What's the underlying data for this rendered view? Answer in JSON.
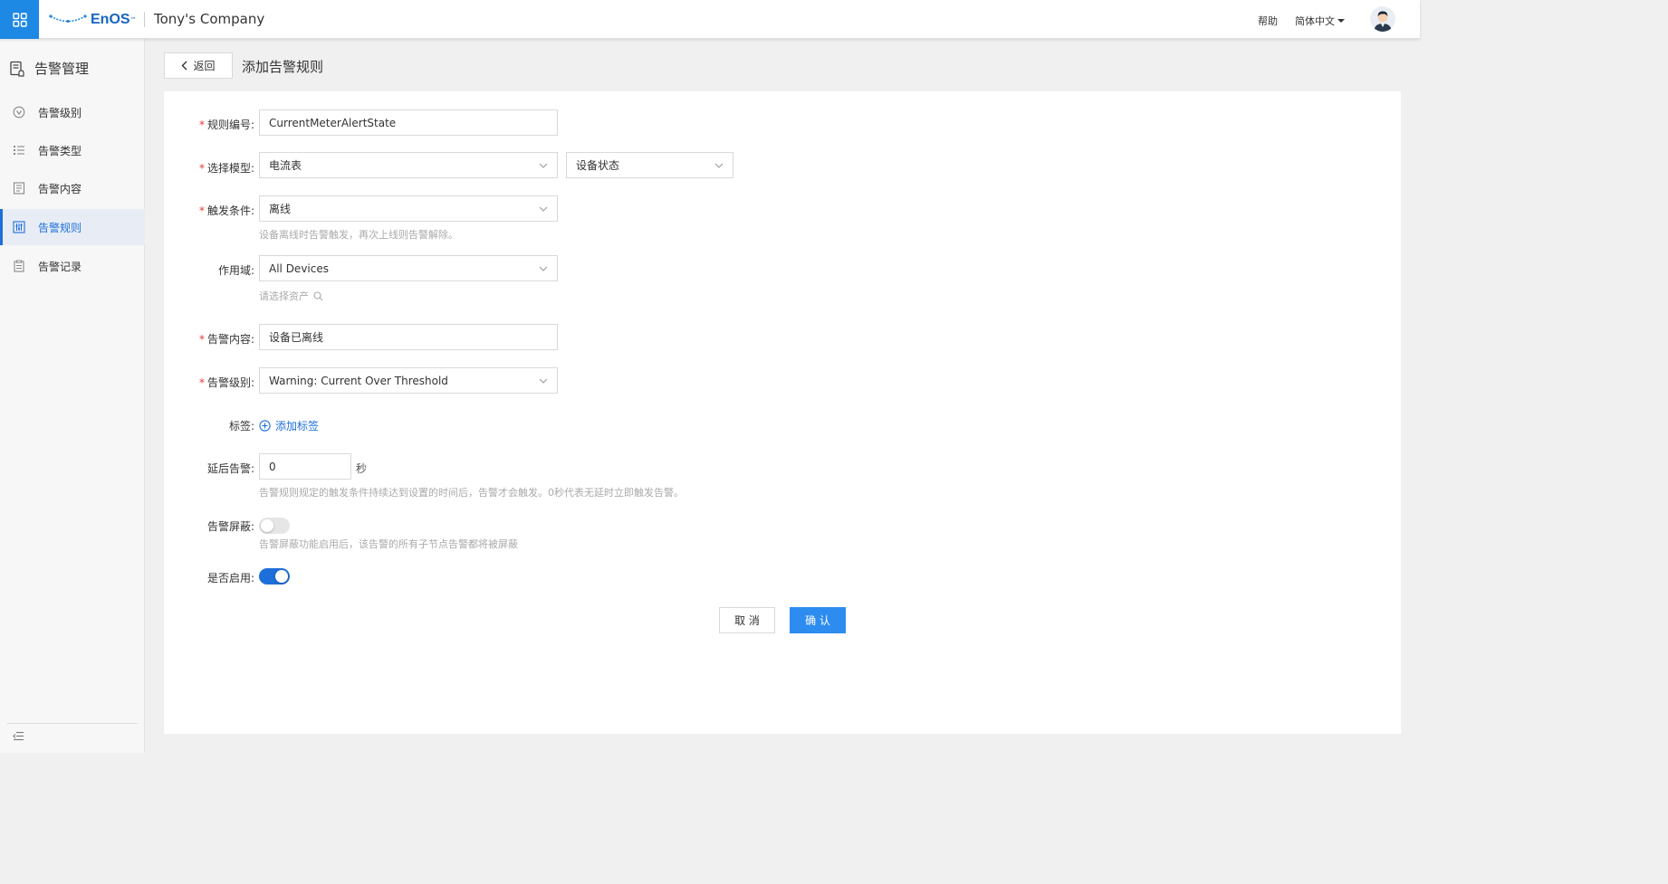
{
  "topbar": {
    "brand": "EnOS",
    "brand_tm": "™",
    "company": "Tony's Company",
    "help": "帮助",
    "language": "简体中文"
  },
  "sidebar": {
    "title": "告警管理",
    "items": [
      {
        "label": "告警级别",
        "icon": "alert-level-icon",
        "active": false
      },
      {
        "label": "告警类型",
        "icon": "list-icon",
        "active": false
      },
      {
        "label": "告警内容",
        "icon": "document-icon",
        "active": false
      },
      {
        "label": "告警规则",
        "icon": "rule-sliders-icon",
        "active": true
      },
      {
        "label": "告警记录",
        "icon": "record-icon",
        "active": false
      }
    ]
  },
  "header": {
    "back": "返回",
    "title": "添加告警规则"
  },
  "form": {
    "rule_id": {
      "label": "规则编号:",
      "value": "CurrentMeterAlertState",
      "required": true
    },
    "model": {
      "label": "选择模型:",
      "value": "电流表",
      "measure": "设备状态",
      "required": true
    },
    "trigger": {
      "label": "触发条件:",
      "value": "离线",
      "hint": "设备离线时告警触发，再次上线则告警解除。",
      "required": true
    },
    "scope": {
      "label": "作用域:",
      "value": "All Devices",
      "asset_placeholder": "请选择资产"
    },
    "content": {
      "label": "告警内容:",
      "value": "设备已离线",
      "required": true
    },
    "level": {
      "label": "告警级别:",
      "value": "Warning: Current Over Threshold",
      "required": true
    },
    "tags": {
      "label": "标签:",
      "add": "添加标签"
    },
    "delay": {
      "label": "延后告警:",
      "value": "0",
      "unit": "秒",
      "hint": "告警规则规定的触发条件持续达到设置的时间后，告警才会触发。0秒代表无延时立即触发告警。"
    },
    "mask": {
      "label": "告警屏蔽:",
      "enabled": false,
      "hint": "告警屏蔽功能启用后，该告警的所有子节点告警都将被屏蔽"
    },
    "enable": {
      "label": "是否启用:",
      "enabled": true
    }
  },
  "actions": {
    "cancel": "取 消",
    "confirm": "确 认"
  },
  "colors": {
    "accent": "#1e6fd9",
    "primary_button": "#2d8cf0",
    "required": "#e53935"
  }
}
